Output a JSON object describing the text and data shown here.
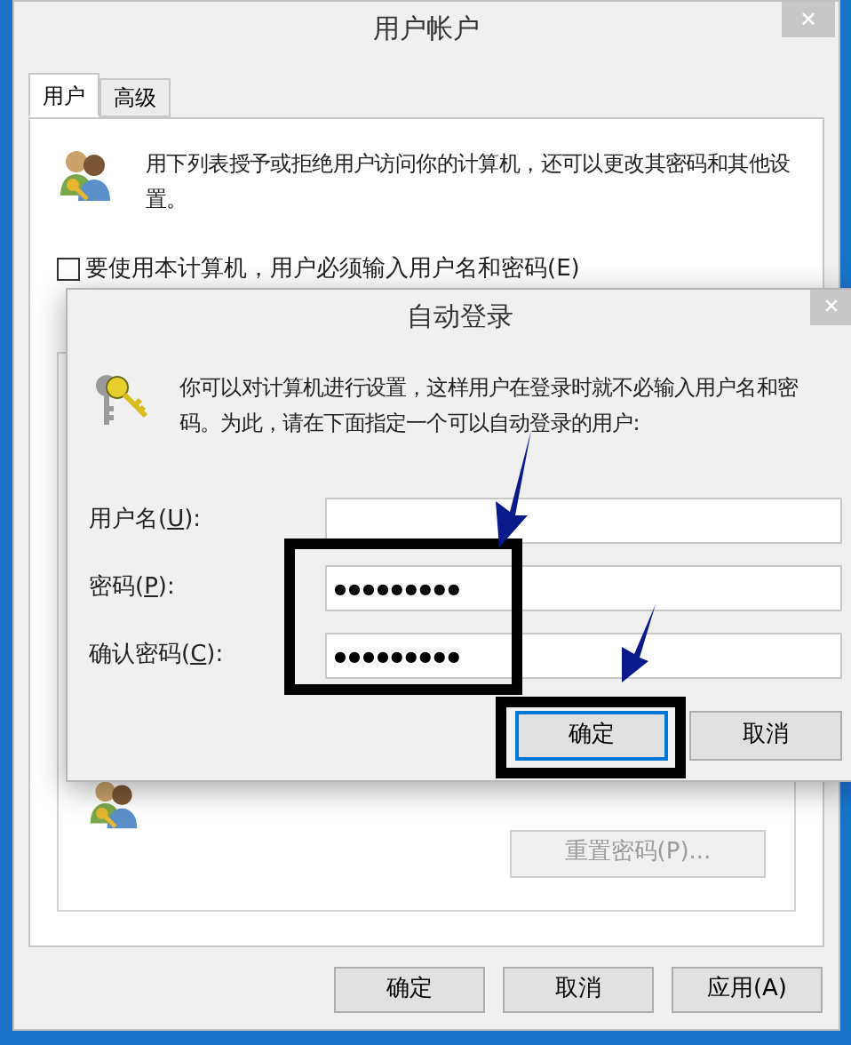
{
  "window": {
    "title": "用户帐户",
    "close": "✕"
  },
  "tabs": [
    {
      "label": "用户",
      "selected": true
    },
    {
      "label": "高级",
      "selected": false
    }
  ],
  "intro": "用下列表授予或拒绝用户访问你的计算机，还可以更改其密码和其他设置。",
  "require_login": {
    "label": "要使用本计算机，用户必须输入用户名和密码(E)",
    "checked": false
  },
  "reset_password": {
    "label": "重置密码(P)...",
    "disabled": true
  },
  "buttons": [
    {
      "label": "确定",
      "disabled": false
    },
    {
      "label": "取消",
      "disabled": false
    },
    {
      "label": "应用(A)",
      "disabled": false
    }
  ],
  "dialog": {
    "title": "自动登录",
    "close": "✕",
    "description": "你可以对计算机进行设置，这样用户在登录时就不必输入用户名和密码。为此，请在下面指定一个可以自动登录的用户:",
    "fields": [
      {
        "before": "用户名(",
        "key": "U",
        "after": "):"
      },
      {
        "before": "密码(",
        "key": "P",
        "after": "):",
        "value": "●●●●●●●●●"
      },
      {
        "before": "确认密码(",
        "key": "C",
        "after": "):",
        "value": "●●●●●●●●●"
      }
    ],
    "buttons": [
      {
        "label": "确定",
        "focused": true
      },
      {
        "label": "取消",
        "focused": false
      }
    ]
  }
}
